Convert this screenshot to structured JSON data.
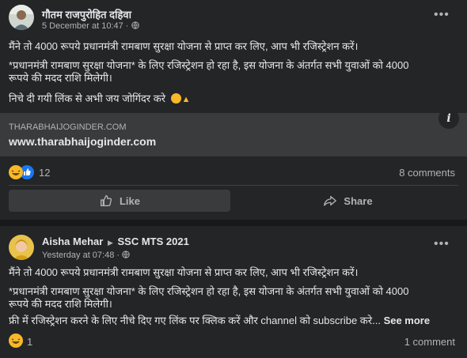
{
  "post1": {
    "author": "गौतम राजपुरोहित दहिवा",
    "timestamp": "5 December at 10:47",
    "lines": [
      "मैंने तो 4000 रूपये प्रधानमंत्री रामबाण सुरक्षा योजना से प्राप्त कर लिए, आप भी रजिस्ट्रेशन करें।",
      "*प्रधानमंत्री रामबाण सुरक्षा योजना* के लिए रजिस्ट्रेशन हो रहा है, इस योजना के अंतर्गत सभी युवाओं को 4000",
      "रूपये की मदद राशि मिलेगी।",
      "निचे दी गयी लिंक से अभी जय जोगिंदर करे"
    ],
    "link_domain": "THARABHAIJOGINDER.COM",
    "link_title": "www.tharabhaijoginder.com",
    "reaction_count": "12",
    "comments": "8 comments",
    "like_label": "Like",
    "share_label": "Share"
  },
  "post2": {
    "author": "Aisha Mehar",
    "group": "SSC MTS 2021",
    "timestamp": "Yesterday at 07:48",
    "lines": [
      "मैंने तो 4000 रूपये प्रधानमंत्री रामबाण सुरक्षा योजना से प्राप्त कर लिए, आप भी रजिस्ट्रेशन करें।",
      "*प्रधानमंत्री रामबाण सुरक्षा योजना* के लिए रजिस्ट्रेशन हो रहा है, इस योजना के अंतर्गत सभी युवाओं को 4000",
      "रूपये की मदद राशि मिलेगी।",
      "फ्री में रजिस्ट्रेशन करने के लिए नीचे दिए गए लिंक पर क्लिक करें और channel को subscribe करे..."
    ],
    "see_more": "See more",
    "reaction_count": "1",
    "comments": "1 comment"
  },
  "colors": {
    "card": "#242526",
    "background": "#18191a",
    "like_blue": "#1877f2",
    "haha_yellow": "#f7b928"
  },
  "icons": [
    "globe-icon",
    "more-options-icon",
    "info-icon",
    "haha-reaction-icon",
    "like-reaction-icon",
    "thumbs-up-icon",
    "share-arrow-icon",
    "rofl-emoji",
    "folded-hands-emoji",
    "triangle-arrow-icon"
  ]
}
